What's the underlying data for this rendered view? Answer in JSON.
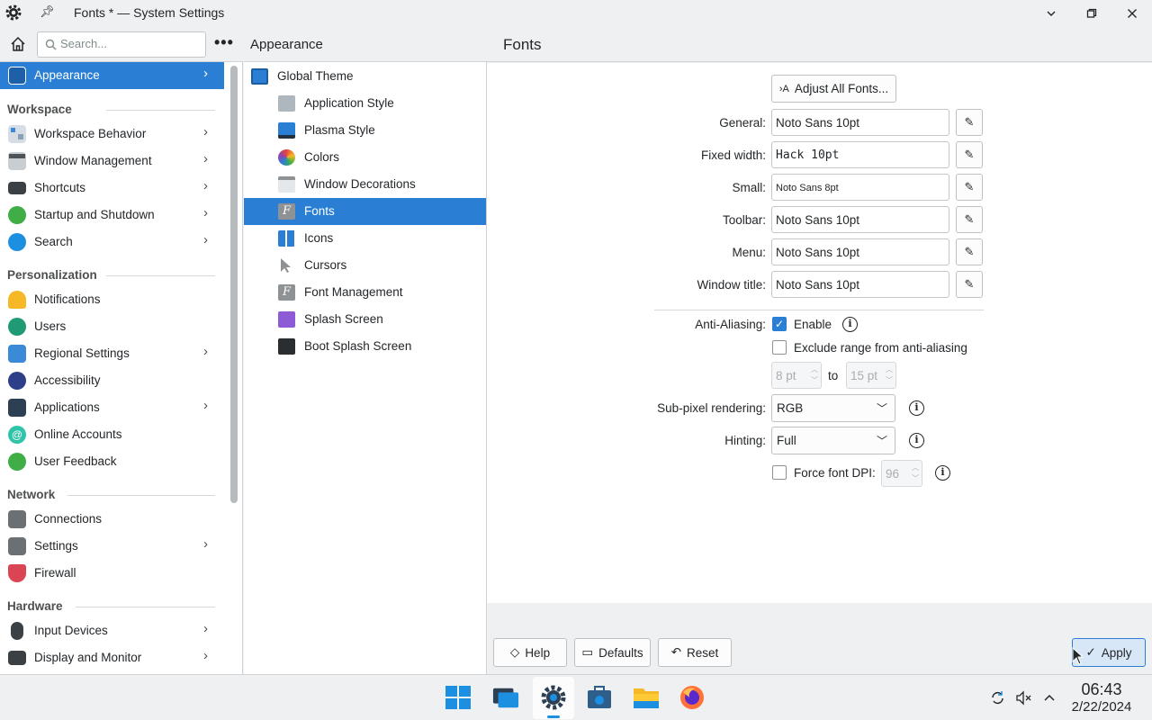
{
  "window": {
    "title": "Fonts * — System Settings",
    "minimize_icon": "chevron-down-icon",
    "maximize_icon": "restore-icon",
    "close_icon": "close-icon"
  },
  "sidebar": {
    "search_placeholder": "Search...",
    "selected": {
      "label": "Appearance"
    },
    "groups": [
      {
        "title": "Workspace",
        "items": [
          {
            "label": "Workspace Behavior",
            "chevron": true
          },
          {
            "label": "Window Management",
            "chevron": true
          },
          {
            "label": "Shortcuts",
            "chevron": true
          },
          {
            "label": "Startup and Shutdown",
            "chevron": true
          },
          {
            "label": "Search",
            "chevron": true
          }
        ]
      },
      {
        "title": "Personalization",
        "items": [
          {
            "label": "Notifications",
            "chevron": false
          },
          {
            "label": "Users",
            "chevron": false
          },
          {
            "label": "Regional Settings",
            "chevron": true
          },
          {
            "label": "Accessibility",
            "chevron": false
          },
          {
            "label": "Applications",
            "chevron": true
          },
          {
            "label": "Online Accounts",
            "chevron": false
          },
          {
            "label": "User Feedback",
            "chevron": false
          }
        ]
      },
      {
        "title": "Network",
        "items": [
          {
            "label": "Connections",
            "chevron": false
          },
          {
            "label": "Settings",
            "chevron": true
          },
          {
            "label": "Firewall",
            "chevron": false
          }
        ]
      },
      {
        "title": "Hardware",
        "items": [
          {
            "label": "Input Devices",
            "chevron": true
          },
          {
            "label": "Display and Monitor",
            "chevron": true
          }
        ]
      }
    ]
  },
  "middle": {
    "title": "Appearance",
    "items": [
      {
        "label": "Global Theme",
        "indent": false
      },
      {
        "label": "Application Style",
        "indent": true
      },
      {
        "label": "Plasma Style",
        "indent": true
      },
      {
        "label": "Colors",
        "indent": true
      },
      {
        "label": "Window Decorations",
        "indent": true
      },
      {
        "label": "Fonts",
        "indent": true,
        "selected": true
      },
      {
        "label": "Icons",
        "indent": true
      },
      {
        "label": "Cursors",
        "indent": true
      },
      {
        "label": "Font Management",
        "indent": true
      },
      {
        "label": "Splash Screen",
        "indent": true
      },
      {
        "label": "Boot Splash Screen",
        "indent": true
      }
    ]
  },
  "main": {
    "title": "Fonts",
    "adjust_all_label": "Adjust All Fonts...",
    "fonts": [
      {
        "label": "General:",
        "value": "Noto Sans 10pt"
      },
      {
        "label": "Fixed width:",
        "value": "Hack 10pt"
      },
      {
        "label": "Small:",
        "value": "Noto Sans 8pt"
      },
      {
        "label": "Toolbar:",
        "value": "Noto Sans 10pt"
      },
      {
        "label": "Menu:",
        "value": "Noto Sans 10pt"
      },
      {
        "label": "Window title:",
        "value": "Noto Sans 10pt"
      }
    ],
    "antialiasing": {
      "label": "Anti-Aliasing:",
      "enable_label": "Enable",
      "enabled": true,
      "exclude_label": "Exclude range from anti-aliasing",
      "exclude_checked": false,
      "range_from": "8 pt",
      "range_to_label": "to",
      "range_to": "15 pt"
    },
    "subpixel": {
      "label": "Sub-pixel rendering:",
      "value": "RGB"
    },
    "hinting": {
      "label": "Hinting:",
      "value": "Full"
    },
    "force_dpi": {
      "label": "Force font DPI:",
      "checked": false,
      "value": "96"
    },
    "buttons": {
      "help": "Help",
      "defaults": "Defaults",
      "reset": "Reset",
      "apply": "Apply"
    }
  },
  "taskbar": {
    "time": "06:43",
    "date": "2/22/2024"
  },
  "colors": {
    "accent": "#2a7fd4"
  }
}
